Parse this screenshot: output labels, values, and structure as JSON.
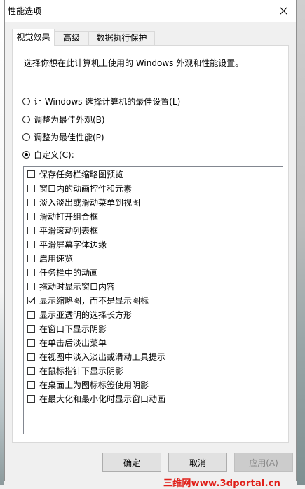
{
  "window": {
    "title": "性能选项"
  },
  "tabs": [
    {
      "label": "视觉效果",
      "active": true
    },
    {
      "label": "高级",
      "active": false
    },
    {
      "label": "数据执行保护",
      "active": false
    }
  ],
  "intro": "选择你想在此计算机上使用的 Windows 外观和性能设置。",
  "options": [
    {
      "label": "让 Windows 选择计算机的最佳设置(L)",
      "checked": false
    },
    {
      "label": "调整为最佳外观(B)",
      "checked": false
    },
    {
      "label": "调整为最佳性能(P)",
      "checked": false
    },
    {
      "label": "自定义(C):",
      "checked": true
    }
  ],
  "effects": [
    {
      "label": "保存任务栏缩略图预览",
      "checked": false
    },
    {
      "label": "窗口内的动画控件和元素",
      "checked": false
    },
    {
      "label": "淡入淡出或滑动菜单到视图",
      "checked": false
    },
    {
      "label": "滑动打开组合框",
      "checked": false
    },
    {
      "label": "平滑滚动列表框",
      "checked": false
    },
    {
      "label": "平滑屏幕字体边缘",
      "checked": false
    },
    {
      "label": "启用速览",
      "checked": false
    },
    {
      "label": "任务栏中的动画",
      "checked": false
    },
    {
      "label": "拖动时显示窗口内容",
      "checked": false
    },
    {
      "label": "显示缩略图，而不是显示图标",
      "checked": true
    },
    {
      "label": "显示亚透明的选择长方形",
      "checked": false
    },
    {
      "label": "在窗口下显示阴影",
      "checked": false
    },
    {
      "label": "在单击后淡出菜单",
      "checked": false
    },
    {
      "label": "在视图中淡入淡出或滑动工具提示",
      "checked": false
    },
    {
      "label": "在鼠标指针下显示阴影",
      "checked": false
    },
    {
      "label": "在桌面上为图标标签使用阴影",
      "checked": false
    },
    {
      "label": "在最大化和最小化时显示窗口动画",
      "checked": false
    }
  ],
  "buttons": {
    "ok": "确定",
    "cancel": "取消",
    "apply": "应用(A)"
  },
  "watermark": "三维网www.3dportal.cn"
}
